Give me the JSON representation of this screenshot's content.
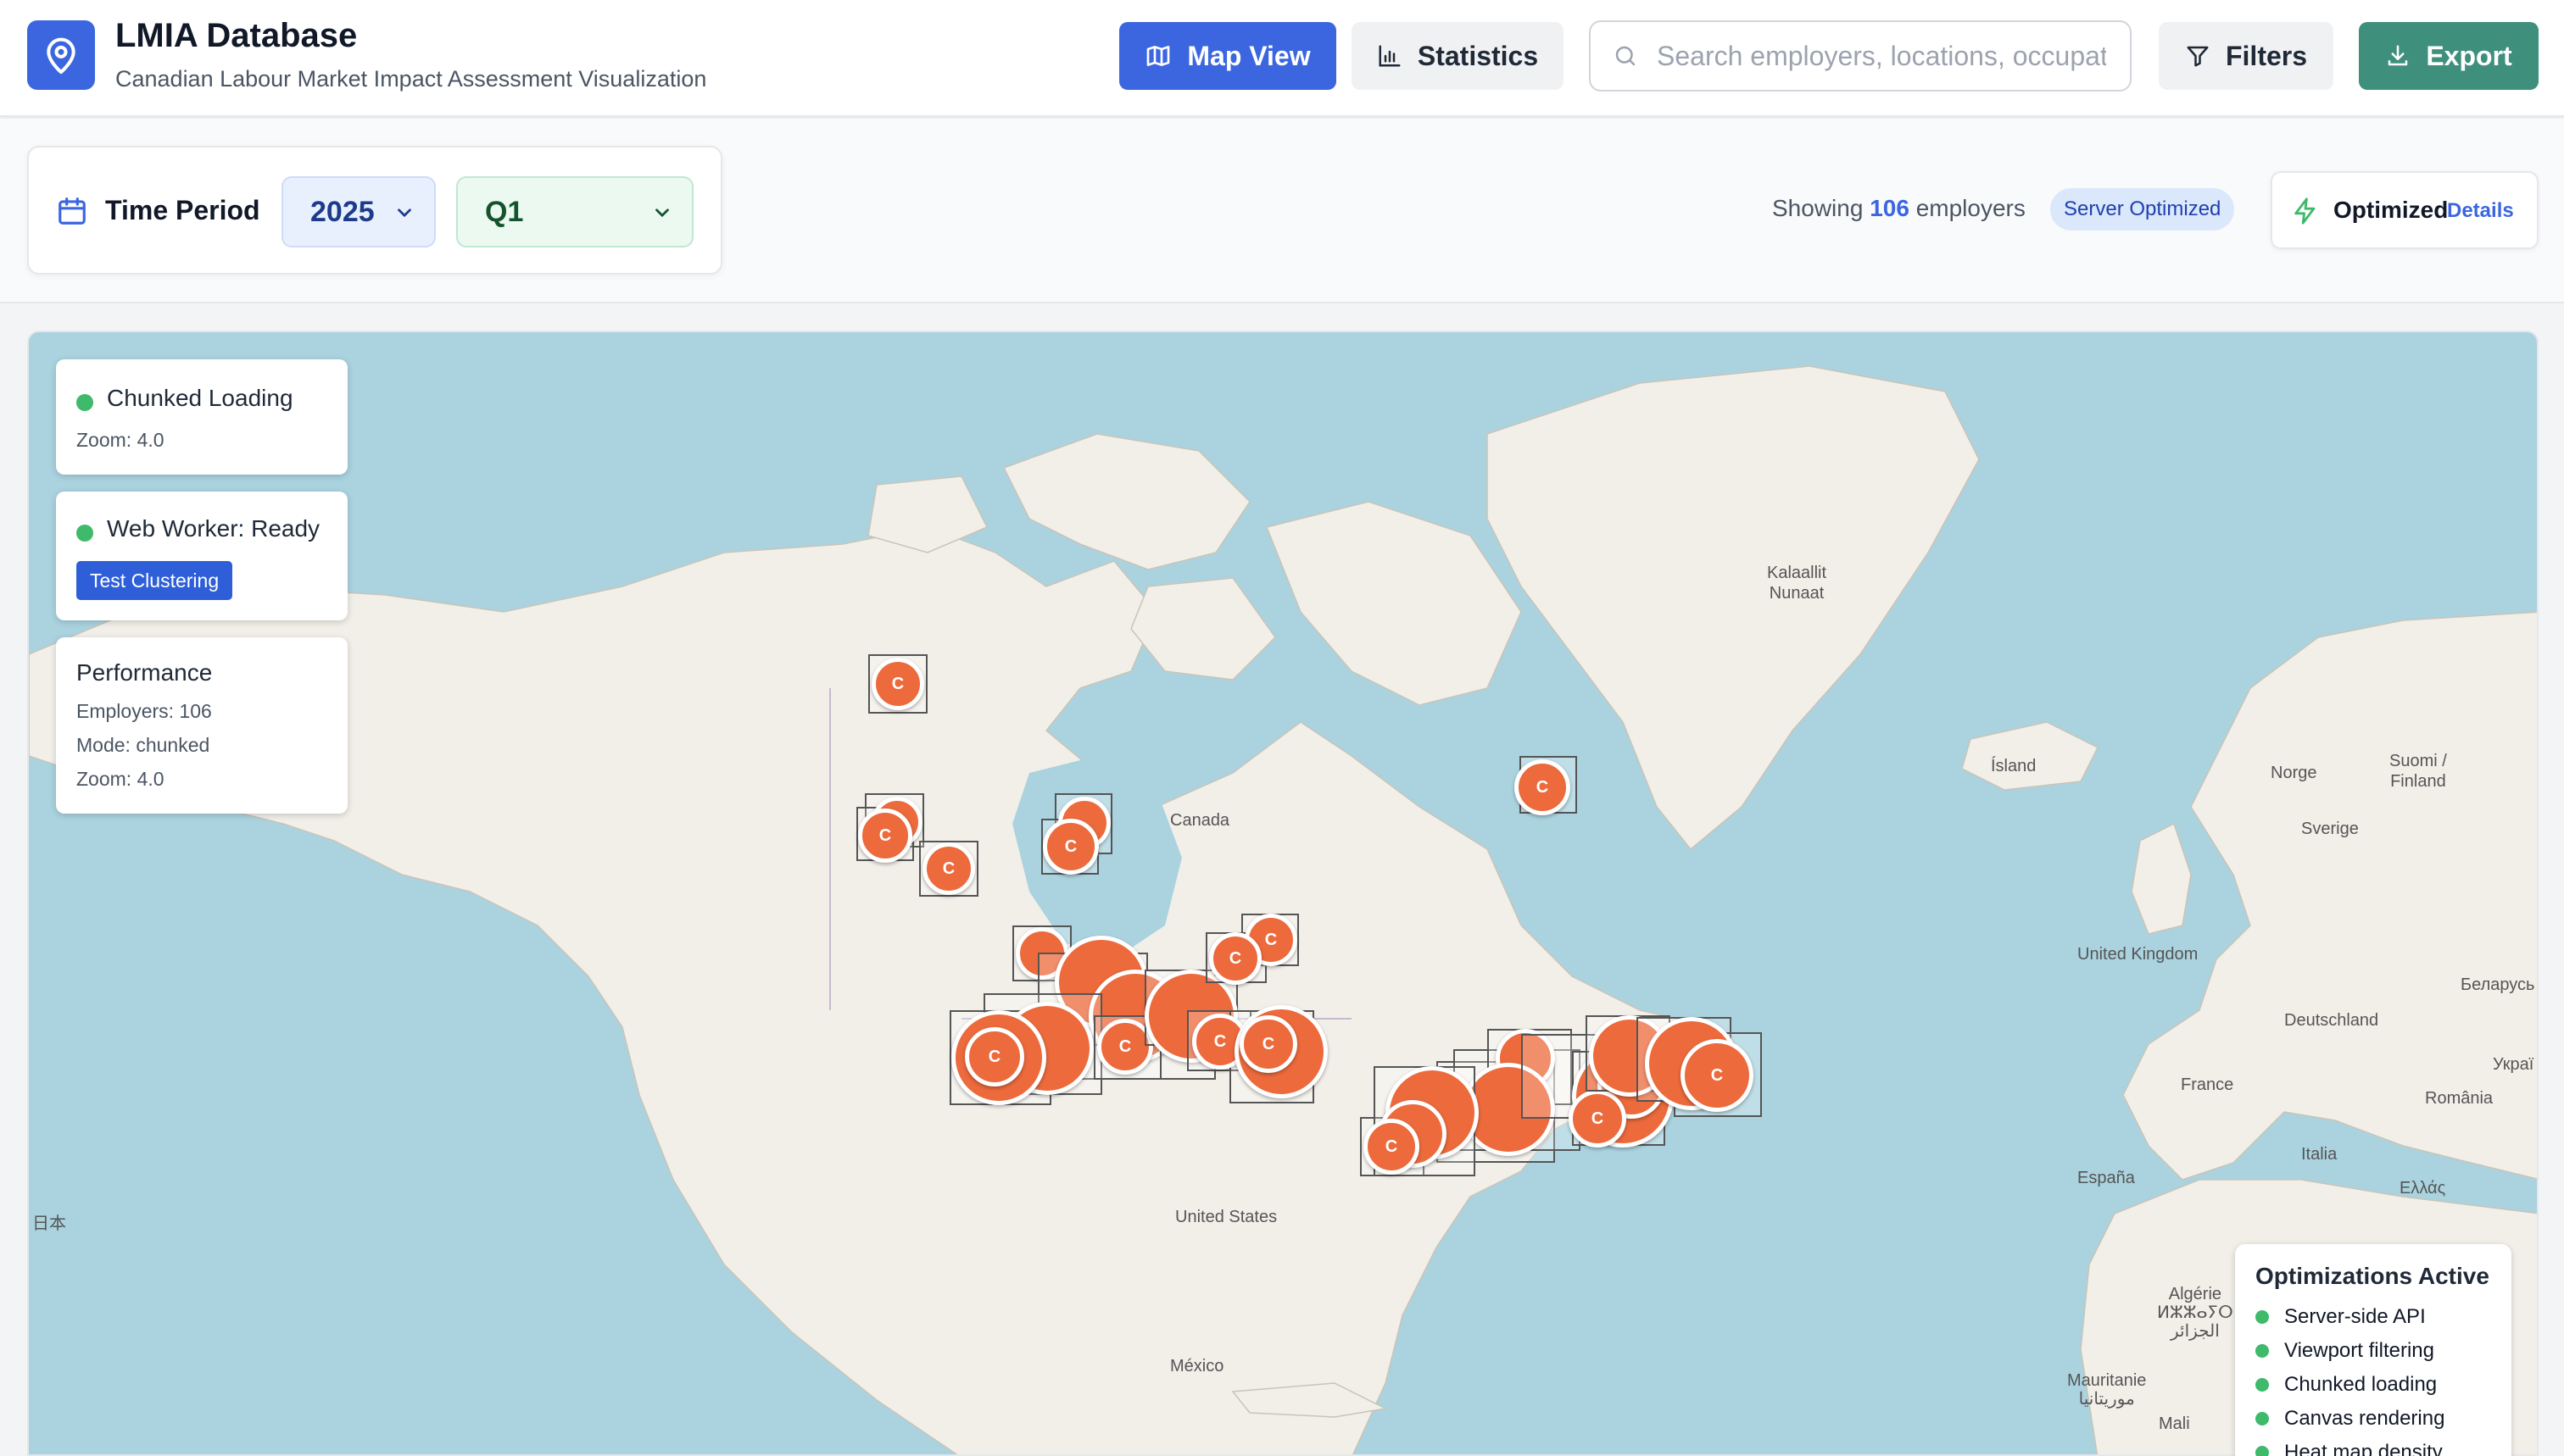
{
  "header": {
    "title": "LMIA Database",
    "subtitle": "Canadian Labour Market Impact Assessment Visualization",
    "map_view_label": "Map View",
    "statistics_label": "Statistics",
    "search_placeholder": "Search employers, locations, occupations...",
    "filters_label": "Filters",
    "export_label": "Export"
  },
  "toolbar": {
    "time_period_label": "Time Period",
    "year": "2025",
    "quarter": "Q1",
    "showing_prefix": "Showing",
    "employer_count": "106",
    "showing_suffix": "employers",
    "server_badge": "Server Optimized",
    "optimized_label": "Optimized",
    "details_label": "Details"
  },
  "map": {
    "labels": {
      "greenland": "Kalaallit\nNunaat",
      "canada": "Canada",
      "island": "Ísland",
      "norge": "Norge",
      "suomi": "Suomi /\nFinland",
      "sverige": "Sverige",
      "uk": "United Kingdom",
      "belarus": "Беларусь",
      "deutschland": "Deutschland",
      "ukraine": "Украї",
      "france": "France",
      "romania": "România",
      "espana": "España",
      "italia": "Italia",
      "ellas": "Ελλάς",
      "us": "United States",
      "japan": "日本",
      "mexico": "México",
      "algerie": "Algérie\nⵍⵣⵣⴰⵢⵔ\nالجزائر",
      "mauritanie": "Mauritanie\nموريتانيا",
      "mali": "Mali"
    },
    "cluster_letter": "C"
  },
  "status_cards": {
    "chunked_title": "Chunked Loading",
    "chunked_zoom": "Zoom: 4.0",
    "worker_title": "Web Worker: Ready",
    "test_button": "Test Clustering",
    "perf_title": "Performance",
    "perf_employers": "Employers: 106",
    "perf_mode": "Mode: chunked",
    "perf_zoom": "Zoom: 4.0"
  },
  "optimizations": {
    "title": "Optimizations Active",
    "items": [
      "Server-side API",
      "Viewport filtering",
      "Chunked loading",
      "Canvas rendering",
      "Heat map density"
    ]
  },
  "colors": {
    "primary": "#3b66e0",
    "export": "#3f8f7d",
    "cluster": "#ec6a3c",
    "status_green": "#3fb96a",
    "water": "#aad3df",
    "land": "#f2efe9"
  }
}
